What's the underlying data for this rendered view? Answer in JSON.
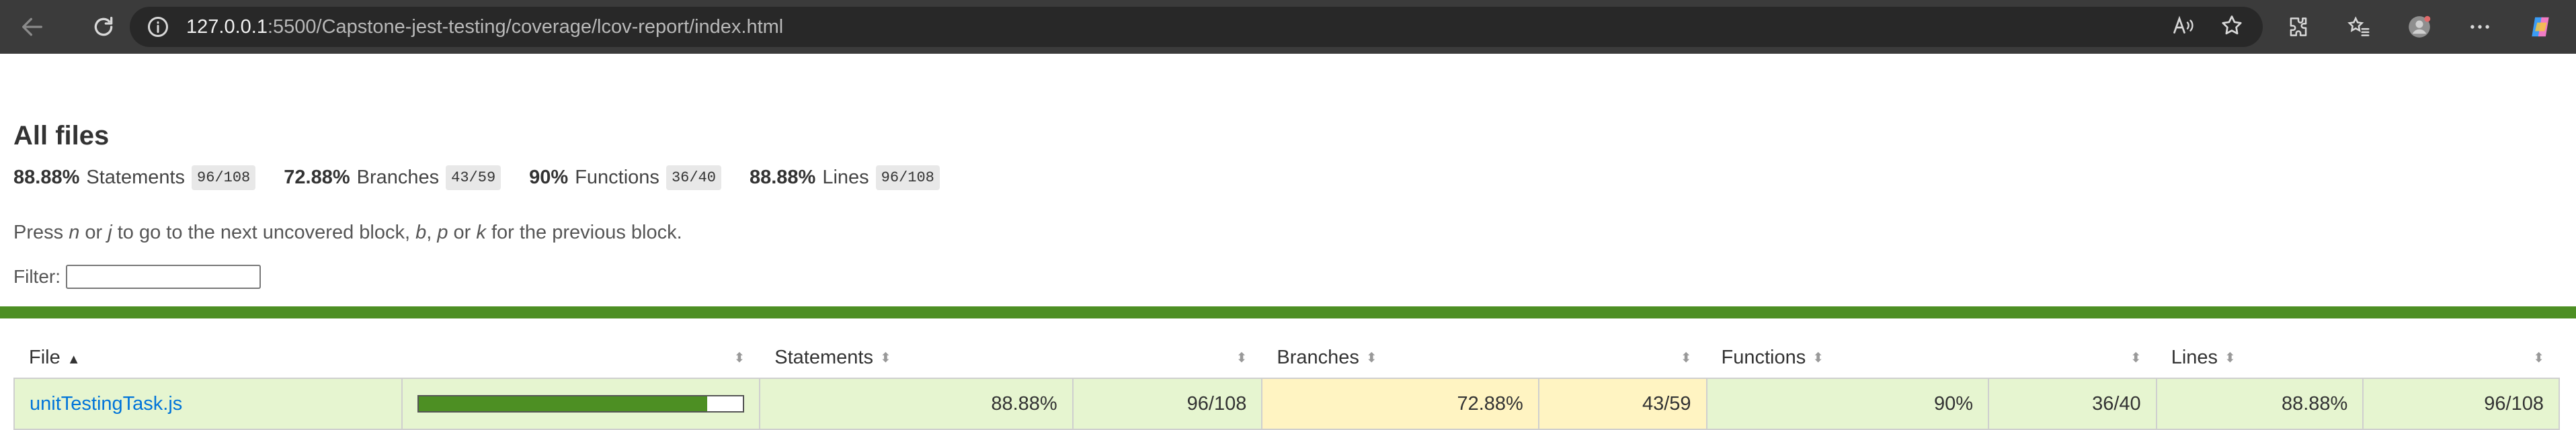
{
  "browser": {
    "url_host": "127.0.0.1",
    "url_path": ":5500/Capstone-jest-testing/coverage/lcov-report/index.html"
  },
  "page": {
    "title": "All files",
    "summary": [
      {
        "pct": "88.88%",
        "label": "Statements",
        "fraction": "96/108"
      },
      {
        "pct": "72.88%",
        "label": "Branches",
        "fraction": "43/59"
      },
      {
        "pct": "90%",
        "label": "Functions",
        "fraction": "36/40"
      },
      {
        "pct": "88.88%",
        "label": "Lines",
        "fraction": "96/108"
      }
    ],
    "hint": {
      "part1": "Press ",
      "k1": "n",
      "part2": " or ",
      "k2": "j",
      "part3": " to go to the next uncovered block, ",
      "k3": "b",
      "part4": ", ",
      "k4": "p",
      "part5": " or ",
      "k5": "k",
      "part6": " for the previous block."
    },
    "filter_label": "Filter:",
    "filter_value": ""
  },
  "table": {
    "headers": {
      "file": "File",
      "statements": "Statements",
      "branches": "Branches",
      "functions": "Functions",
      "lines": "Lines"
    },
    "rows": [
      {
        "file": "unitTestingTask.js",
        "coverage_fraction": 0.8888,
        "statements_pct": "88.88%",
        "statements_frac": "96/108",
        "branches_pct": "72.88%",
        "branches_frac": "43/59",
        "functions_pct": "90%",
        "functions_frac": "36/40",
        "lines_pct": "88.88%",
        "lines_frac": "96/108"
      }
    ]
  },
  "colors": {
    "accent_green": "#4d8f23",
    "high_bg": "#e6f5d0",
    "medium_bg": "#fff4c2",
    "link": "#0074d9"
  }
}
